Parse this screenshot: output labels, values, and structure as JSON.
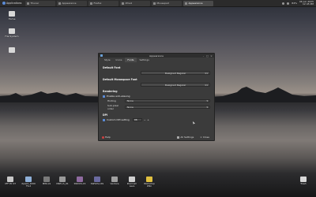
{
  "panel": {
    "apps_label": "Applications",
    "tasks": [
      {
        "label": "Thunar",
        "active": false
      },
      {
        "label": "Appearance",
        "active": false
      },
      {
        "label": "Firefox",
        "active": false
      },
      {
        "label": "Xfce4",
        "active": false
      },
      {
        "label": "Mousepad",
        "active": false
      },
      {
        "label": "Appearance",
        "active": true
      }
    ],
    "battery": "84%",
    "clock_date": "06 Jun 2025",
    "clock_time": "12:45 PM"
  },
  "desktop_icons": [
    {
      "label": "Home",
      "icon": "home-icon"
    },
    {
      "label": "File System",
      "icon": "drive-icon"
    },
    {
      "label": "Trash",
      "icon": "trash-icon"
    }
  ],
  "dialog": {
    "title": "Appearance",
    "tabs": [
      "Style",
      "Icons",
      "Fonts",
      "Settings"
    ],
    "active_tab": 2,
    "default_font": {
      "heading": "Default Font",
      "value": "Designed Regular",
      "size": "11"
    },
    "mono_font": {
      "heading": "Default Monospace Font",
      "value": "Designed Regular",
      "size": "11"
    },
    "rendering": {
      "heading": "Rendering",
      "antialias_label": "Enable anti-aliasing",
      "hinting_label": "Hinting",
      "hinting_value": "None",
      "subpixel_label": "Sub-pixel order",
      "subpixel_value": "None"
    },
    "dpi": {
      "heading": "DPI",
      "custom_label": "Custom DPI setting",
      "value": "96"
    },
    "footer": {
      "help": "Help",
      "all_settings": "All Settings",
      "close": "Close"
    }
  },
  "dock": [
    {
      "label": "XFF PC ST",
      "color": "#c8c8c8"
    },
    {
      "label": "Xpaint_1000 TS-2",
      "color": "#8fb0d8"
    },
    {
      "label": "MWI-LS",
      "color": "#7a7a7a"
    },
    {
      "label": "MWI-LS_01",
      "color": "#9a9a9a"
    },
    {
      "label": "SWVUS-15",
      "color": "#8f6aa0"
    },
    {
      "label": "SWVUS-LSS",
      "color": "#6a6aa0"
    },
    {
      "label": "Ventura",
      "color": "#a0a0a0"
    },
    {
      "label": "Premium Leve",
      "color": "#d0d0d0"
    },
    {
      "label": "Workshop Wiki",
      "color": "#e0c040"
    }
  ],
  "trash_label": "Trash"
}
